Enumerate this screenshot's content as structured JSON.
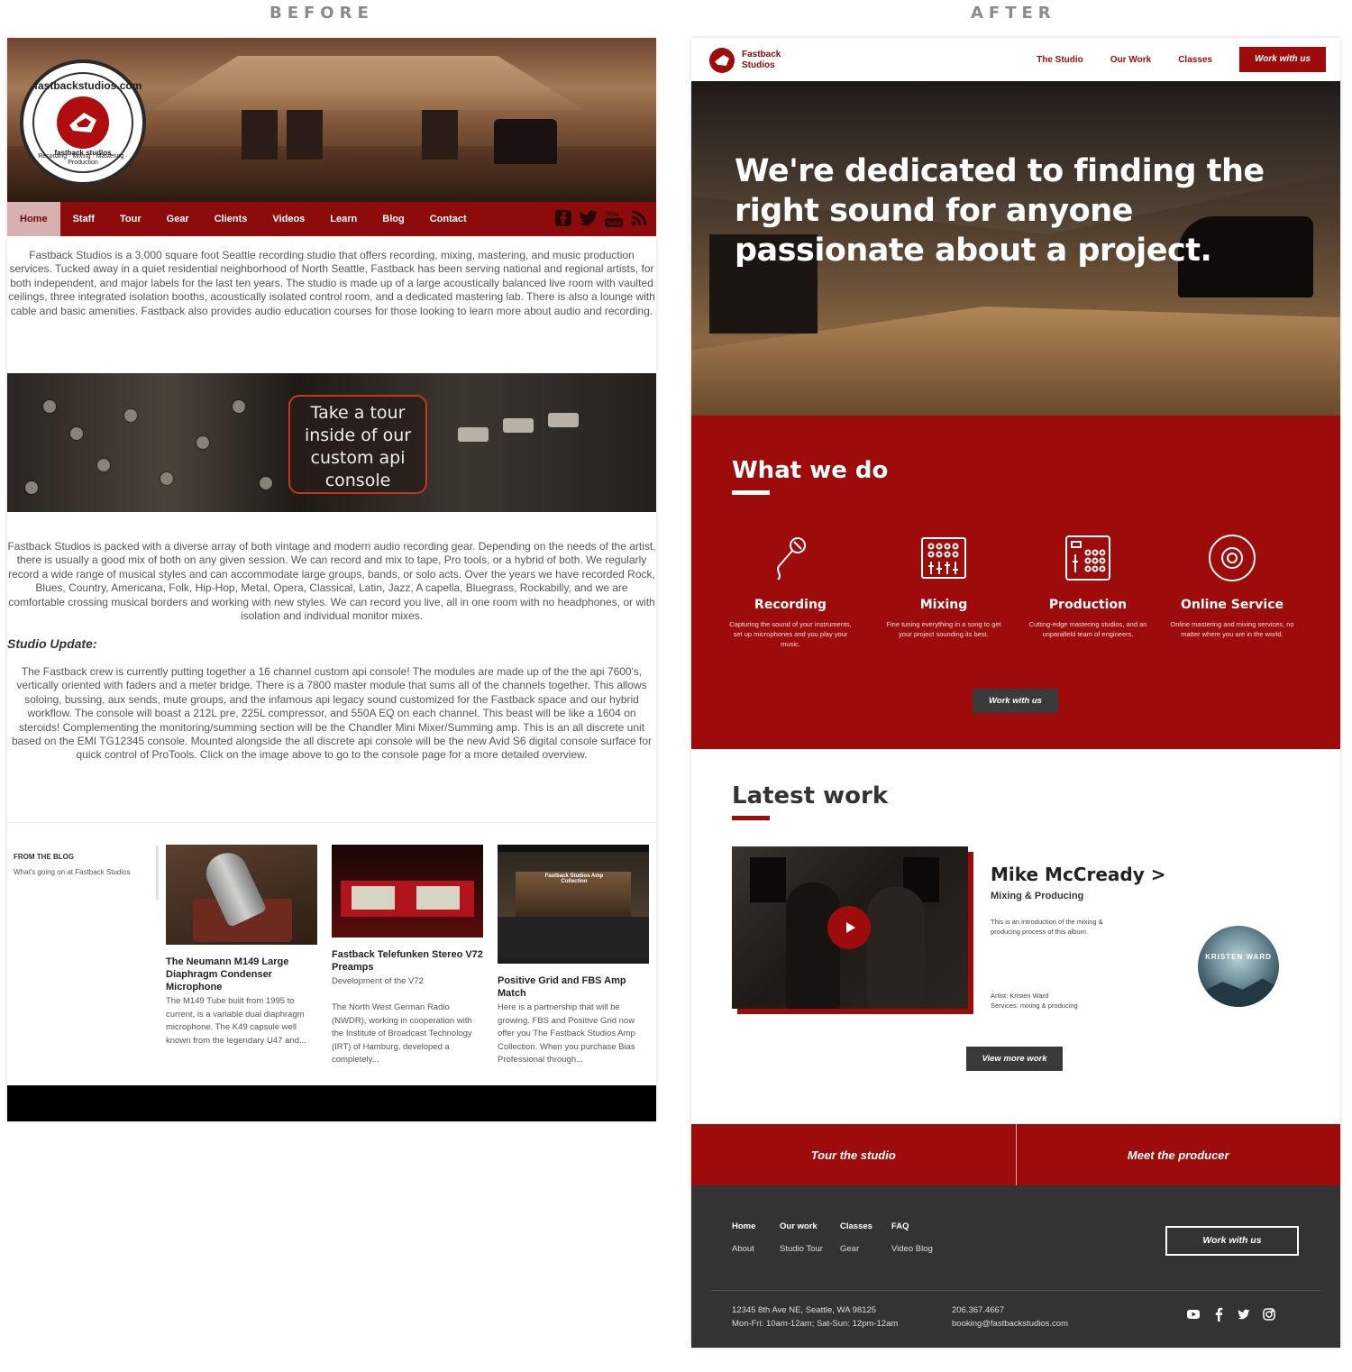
{
  "labels": {
    "before": "BEFORE",
    "after": "AFTER"
  },
  "before": {
    "logo": {
      "brand": "fastbackstudios.com",
      "sub_name": "fastback studios",
      "tagline": "Recording · Mixing · Mastering · Production"
    },
    "nav": [
      "Home",
      "Staff",
      "Tour",
      "Gear",
      "Clients",
      "Videos",
      "Learn",
      "Blog",
      "Contact"
    ],
    "social_icons": [
      "facebook-icon",
      "twitter-icon",
      "youtube-icon",
      "rss-icon"
    ],
    "intro": "Fastback Studios is a 3,000 square foot Seattle recording studio that offers recording, mixing, mastering, and music production services. Tucked away in a quiet residential neighborhood of North Seattle, Fastback has been serving national and regional artists, for both independent, and major labels for the last ten years. The studio is made up of a large acoustically balanced live room with vaulted ceilings, three integrated isolation booths, acoustically isolated control room, and a dedicated mastering lab. There is also a lounge with cable and basic amenities. Fastback also provides audio education courses for those looking to learn more about audio and recording.",
    "banner_text": "Take a tour inside of our custom api console",
    "gear_text": "Fastback Studios is packed with a diverse array of both vintage and modern audio recording gear. Depending on the needs of the artist, there is usually a good mix of both on any given session. We can record and mix to tape, Pro tools, or a hybrid of both. We regularly record a wide range of musical styles and can accommodate large groups, bands, or solo acts. Over the years we have recorded Rock, Blues, Country, Americana, Folk, Hip-Hop, Metal, Opera, Classical, Latin, Jazz, A capella, Bluegrass, Rockabilly, and we are comfortable crossing musical borders and working with new styles. We can record you live, all in one room with no headphones, or with isolation and individual monitor mixes.",
    "update_title": "Studio Update:",
    "update_text": "The Fastback crew is currently putting together a 16 channel custom api console! The modules are made up of the the api 7600's, vertically oriented with faders and a meter bridge. There is a 7800 master module that sums all of the channels together. This allows soloing, bussing, aux sends, mute groups, and the infamous api legacy sound customized for the Fastback space and our hybrid workflow. The console will boast a 212L pre, 225L compressor, and 550A EQ on each channel. This beast will be like a 1604 on steroids! Complementing the monitoring/summing section will be the Chandler Mini Mixer/Summing amp. This is an all discrete unit based on the EMI TG12345 console. Mounted alongside the all discrete api console will be the new Avid S6 digital console surface for quick control of ProTools. Click on the image above to go to the console page for a more detailed overview.",
    "blog": {
      "heading": "FROM THE BLOG",
      "sub": "What's going on at Fastback Studios",
      "posts": [
        {
          "title": "The Neumann M149 Large Diaphragm Condenser Microphone",
          "body": "The M149 Tube built from 1995 to current, is a variable dual diaphragm microphone. The K49 capsule well known from the legendary U47 and..."
        },
        {
          "title": "Fastback Telefunken Stereo V72 Preamps",
          "body": "Development of the V72\n\nThe North West German Radio (NWDR), working in cooperation with the Institute of Broadcast Technology (IRT) of Hamburg, developed a completely..."
        },
        {
          "title": "Positive Grid and FBS Amp Match",
          "body": "Here is a partnership that will be growing. FBS and Positive Grid now offer you The Fastback Studios Amp Collection. When you purchase Bias Professional through..."
        }
      ],
      "thumb3_caption": "Fastback Studios Amp Collection"
    }
  },
  "after": {
    "logo": {
      "line1": "Fastback",
      "line2": "Studios"
    },
    "nav": [
      "The Studio",
      "Our Work",
      "Classes"
    ],
    "nav_cta": "Work with us",
    "headline": "We're dedicated to finding the right sound for anyone passionate about a project.",
    "what": {
      "title": "What we do",
      "services": [
        {
          "icon": "microphone-icon",
          "name": "Recording",
          "desc": "Capturing the sound of your instruments, set up microphones and you play your music."
        },
        {
          "icon": "mixer-icon",
          "name": "Mixing",
          "desc": "Fine tuning everything in a song to get your project sounding its best."
        },
        {
          "icon": "drum-pad-icon",
          "name": "Production",
          "desc": "Cutting-edge mastering studios, and an unparalleld team of engineers."
        },
        {
          "icon": "disc-icon",
          "name": "Online Service",
          "desc": "Online mastering and mixing services, no matter where you are in the world."
        }
      ],
      "cta": "Work with us"
    },
    "latest": {
      "title": "Latest work",
      "name": "Mike McCready >",
      "sub": "Mixing & Producing",
      "desc": "This is an introduction of the mixing & producing process of this album.",
      "artist": "Artist: Kristen Ward",
      "services": "Services: mixing & producing",
      "album_text": "KRISTEN WARD",
      "cta": "View more work"
    },
    "tiles": [
      "Tour the studio",
      "Meet the producer"
    ],
    "footer": {
      "cols": [
        {
          "head": "Home",
          "link": "About"
        },
        {
          "head": "Our work",
          "link": "Studio Tour"
        },
        {
          "head": "Classes",
          "link": "Gear"
        },
        {
          "head": "FAQ",
          "link": "Video Blog"
        }
      ],
      "cta": "Work with us",
      "address": "12345 8th Ave NE, Seattle, WA 98125",
      "hours": "Mon-Fri: 10am-12am; Sat-Sun: 12pm-12am",
      "phone": "206.367.4667",
      "email": "booking@fastbackstudios.com",
      "social_icons": [
        "youtube-icon",
        "facebook-icon",
        "twitter-icon",
        "instagram-icon"
      ]
    }
  },
  "colors": {
    "brand_red": "#9e0b0b",
    "dark": "#333333",
    "before_nav": "#8e0b0b"
  }
}
